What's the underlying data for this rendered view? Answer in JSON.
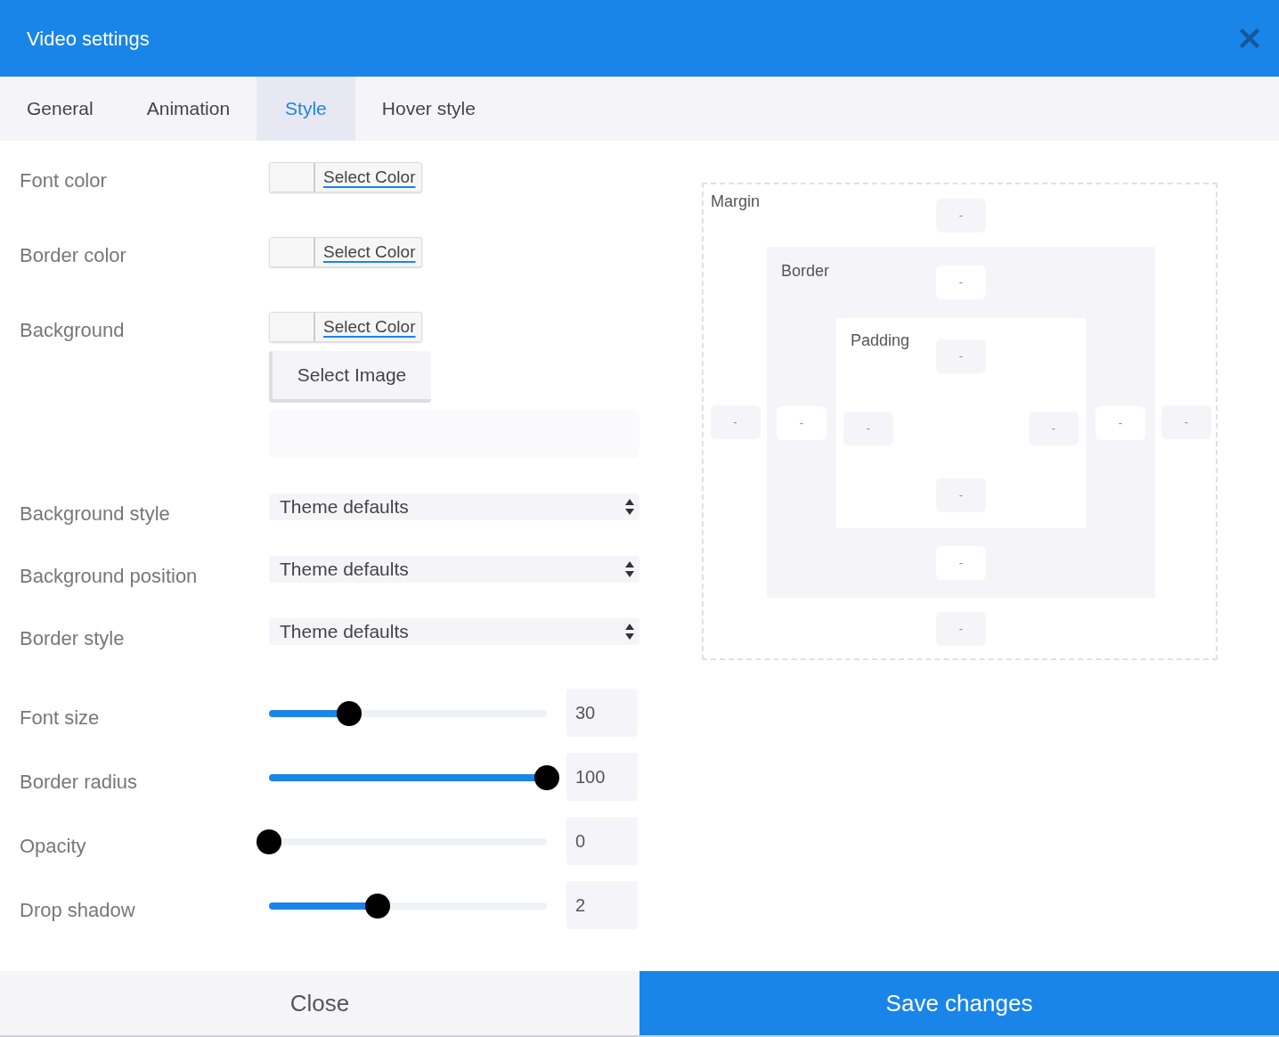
{
  "window": {
    "title": "Video settings"
  },
  "tabs": [
    {
      "label": "General",
      "selected": false
    },
    {
      "label": "Animation",
      "selected": false
    },
    {
      "label": "Style",
      "selected": true
    },
    {
      "label": "Hover style",
      "selected": false
    }
  ],
  "rows": [
    {
      "kind": "color",
      "label": "Font color",
      "button": "Select Color"
    },
    {
      "kind": "color",
      "label": "Border color",
      "button": "Select Color"
    },
    {
      "kind": "color_image",
      "label": "Background",
      "button": "Select Color",
      "image_button": "Select Image"
    },
    {
      "kind": "select",
      "label": "Background style",
      "value": "Theme defaults"
    },
    {
      "kind": "select",
      "label": "Background position",
      "value": "Theme defaults"
    },
    {
      "kind": "select",
      "label": "Border style",
      "value": "Theme defaults"
    },
    {
      "kind": "slider",
      "label": "Font size",
      "level": 0.29,
      "value": "30"
    },
    {
      "kind": "slider",
      "label": "Border radius",
      "level": 1,
      "value": "100"
    },
    {
      "kind": "slider",
      "label": "Opacity",
      "level": 0,
      "value": "0"
    },
    {
      "kind": "slider",
      "label": "Drop shadow",
      "level": 0.39,
      "value": "2"
    }
  ],
  "box_model": {
    "margin": {
      "label": "Margin",
      "top": "-",
      "right": "-",
      "bottom": "-",
      "left": "-"
    },
    "border": {
      "label": "Border",
      "top": "-",
      "right": "-",
      "bottom": "-",
      "left": "-"
    },
    "padding": {
      "label": "Padding",
      "top": "-",
      "right": "-",
      "bottom": "-",
      "left": "-"
    }
  },
  "footer": {
    "close": "Close",
    "save": "Save changes"
  }
}
